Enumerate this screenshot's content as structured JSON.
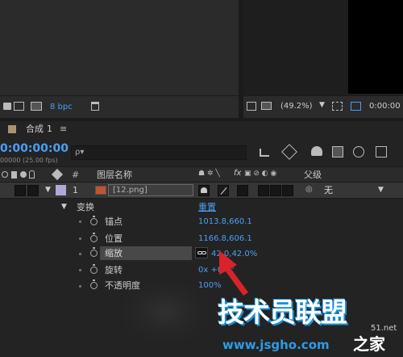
{
  "project": {
    "bit_depth": "8 bpc"
  },
  "viewer": {
    "zoom": "(49.2%)",
    "timecode": "0:00:00"
  },
  "comp": {
    "tab_label": "合成",
    "tab_number": "1",
    "tab_menu": "≡"
  },
  "timeline": {
    "timecode": "0:00:00:00",
    "fps_label": "00000 (25.00 fps)",
    "search_placeholder": "ρ▾",
    "columns": {
      "hash": "#",
      "layer_name": "图层名称",
      "switches": "fx",
      "parent": "父级"
    },
    "layer": {
      "number": "1",
      "name": "[12.png]",
      "parent_value": "无"
    }
  },
  "transform": {
    "group_label": "变换",
    "reset_label": "重置",
    "properties": [
      {
        "label": "锚点",
        "value": "1013.8,660.1"
      },
      {
        "label": "位置",
        "value": "1166.8,606.1"
      },
      {
        "label": "缩放",
        "value": "42.0,42.0%"
      },
      {
        "label": "旋转",
        "value": "0x +0.0°"
      },
      {
        "label": "不透明度",
        "value": "100%"
      }
    ]
  },
  "watermark": {
    "main": "技术员联盟",
    "sub": "www.jsgho.com",
    "sub2": "之家",
    "domain": "51.net"
  },
  "colors": {
    "accent_blue": "#4a9ff5",
    "label_swatch": "#b0a8d8",
    "arrow_red": "#d8232a"
  }
}
